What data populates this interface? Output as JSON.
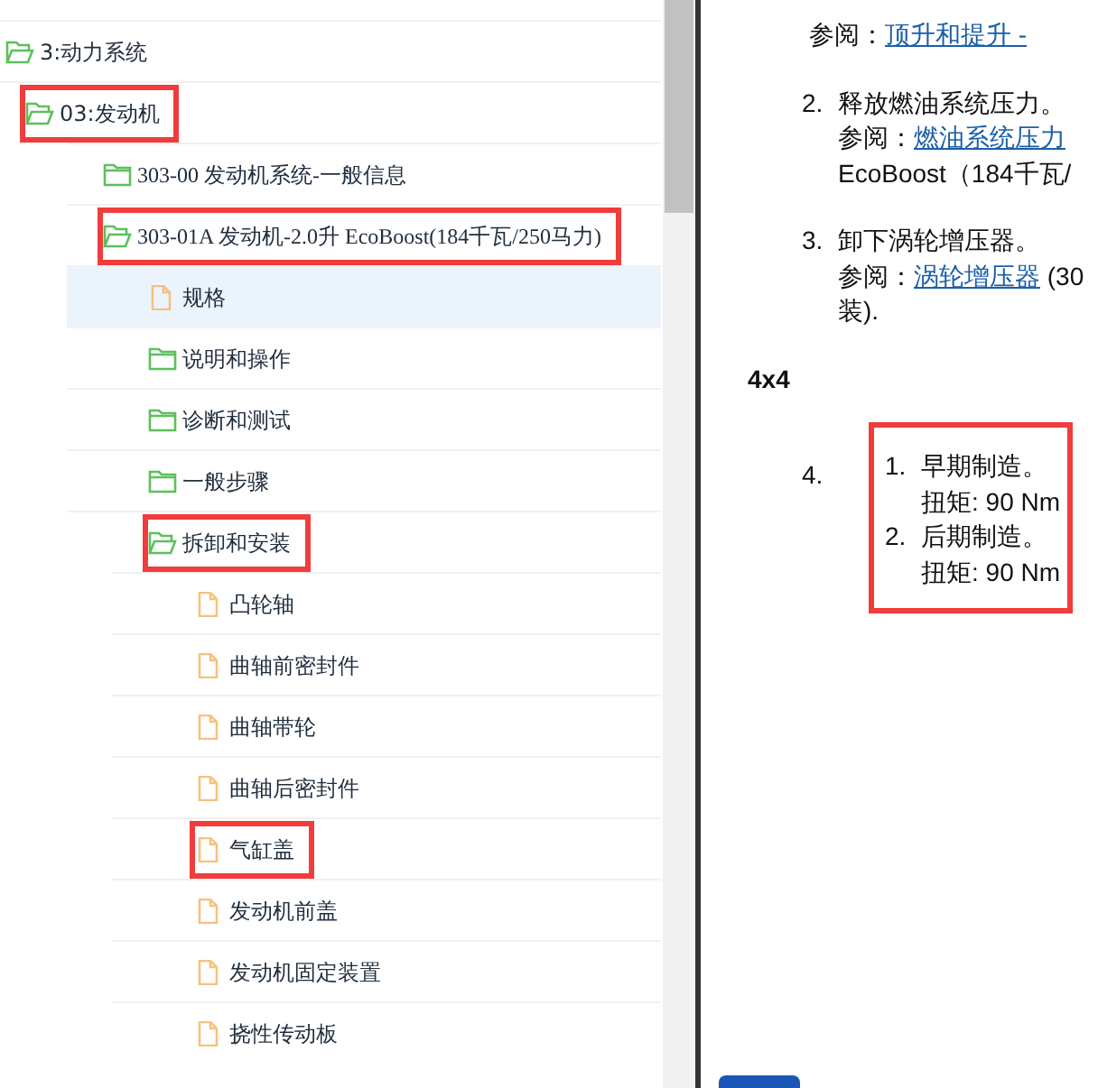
{
  "tree": [
    {
      "label": "3:动力系统",
      "kind": "folder",
      "expanded": true,
      "selected": false,
      "highlighted": false,
      "children": [
        {
          "label": "03:发动机",
          "kind": "folder",
          "expanded": true,
          "selected": false,
          "highlighted": true,
          "children": [
            {
              "label": "303-00 发动机系统-一般信息",
              "kind": "folder",
              "expanded": false,
              "selected": false,
              "highlighted": false
            },
            {
              "label": "303-01A 发动机-2.0升 EcoBoost(184千瓦/250马力)",
              "kind": "folder",
              "expanded": true,
              "selected": false,
              "highlighted": true,
              "children": [
                {
                  "label": "规格",
                  "kind": "file",
                  "selected": true,
                  "highlighted": false
                },
                {
                  "label": "说明和操作",
                  "kind": "folder",
                  "expanded": false,
                  "selected": false,
                  "highlighted": false
                },
                {
                  "label": "诊断和测试",
                  "kind": "folder",
                  "expanded": false,
                  "selected": false,
                  "highlighted": false
                },
                {
                  "label": "一般步骤",
                  "kind": "folder",
                  "expanded": false,
                  "selected": false,
                  "highlighted": false
                },
                {
                  "label": "拆卸和安装",
                  "kind": "folder",
                  "expanded": true,
                  "selected": false,
                  "highlighted": true,
                  "children": [
                    {
                      "label": "凸轮轴",
                      "kind": "file",
                      "selected": false,
                      "highlighted": false
                    },
                    {
                      "label": "曲轴前密封件",
                      "kind": "file",
                      "selected": false,
                      "highlighted": false
                    },
                    {
                      "label": "曲轴带轮",
                      "kind": "file",
                      "selected": false,
                      "highlighted": false
                    },
                    {
                      "label": "曲轴后密封件",
                      "kind": "file",
                      "selected": false,
                      "highlighted": false
                    },
                    {
                      "label": "气缸盖",
                      "kind": "file",
                      "selected": false,
                      "highlighted": true
                    },
                    {
                      "label": "发动机前盖",
                      "kind": "file",
                      "selected": false,
                      "highlighted": false
                    },
                    {
                      "label": "发动机固定装置",
                      "kind": "file",
                      "selected": false,
                      "highlighted": false
                    },
                    {
                      "label": "挠性传动板",
                      "kind": "file",
                      "selected": false,
                      "highlighted": false
                    }
                  ]
                }
              ]
            }
          ]
        }
      ]
    }
  ],
  "content": [
    {
      "kind": "ref",
      "ref_label": "参阅：",
      "link": "顶升和提升 -"
    },
    {
      "kind": "step",
      "number": "2.",
      "title": "释放燃油系统压力。",
      "ref_label": "参阅：",
      "link": "燃油系统压力",
      "extra": "EcoBoost（184千瓦/"
    },
    {
      "kind": "step",
      "number": "3.",
      "title": "卸下涡轮增压器。",
      "ref_label": "参阅：",
      "link": "涡轮增压器",
      "after": " (30",
      "extra": "装)."
    },
    {
      "kind": "heading",
      "title": "4x4"
    },
    {
      "kind": "substeps",
      "number": "4.",
      "highlighted": true,
      "items": [
        {
          "number": "1.",
          "title": "早期制造。",
          "detail": "扭矩: 90 Nm"
        },
        {
          "number": "2.",
          "title": "后期制造。",
          "detail": "扭矩: 90 Nm"
        }
      ]
    }
  ]
}
